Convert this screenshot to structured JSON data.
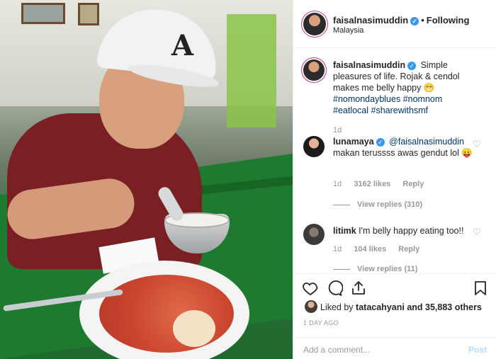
{
  "post": {
    "username": "faisalnasimuddin",
    "following_label": "Following",
    "location": "Malaysia"
  },
  "caption": {
    "username": "faisalnasimuddin",
    "text_1": "Simple pleasures of life. Rojak & cendol makes me belly happy",
    "emoji": "😁",
    "tag_1": "#nomondayblues",
    "tag_2": "#nomnom",
    "tag_3": "#eatlocal",
    "tag_4": "#sharewithsmf",
    "age": "1d"
  },
  "comments": [
    {
      "username": "lunamaya",
      "mention": "@faisalnasimuddin",
      "text": "makan terussss awas gendut lol",
      "emoji": "😛",
      "age": "1d",
      "likes": "3162 likes",
      "reply": "Reply",
      "view_replies": "View replies (310)"
    },
    {
      "username": "litimk",
      "text": "I'm belly happy eating too!!",
      "age": "1d",
      "likes": "104 likes",
      "reply": "Reply",
      "view_replies": "View replies (11)"
    }
  ],
  "likes": {
    "liked_by_prefix": "Liked by",
    "liked_by_user": "tatacahyani",
    "liked_by_suffix": "and 35,883 others"
  },
  "timestamp": "1 DAY AGO",
  "add_comment": {
    "placeholder": "Add a comment...",
    "post_label": "Post"
  },
  "icons": {
    "verified": "verified-badge-icon",
    "like": "heart-icon",
    "comment": "comment-bubble-icon",
    "share": "share-icon",
    "save": "bookmark-icon"
  },
  "colors": {
    "link": "#003569",
    "verified": "#3897f0",
    "muted": "#999999",
    "post_disabled": "#b3dbff"
  }
}
